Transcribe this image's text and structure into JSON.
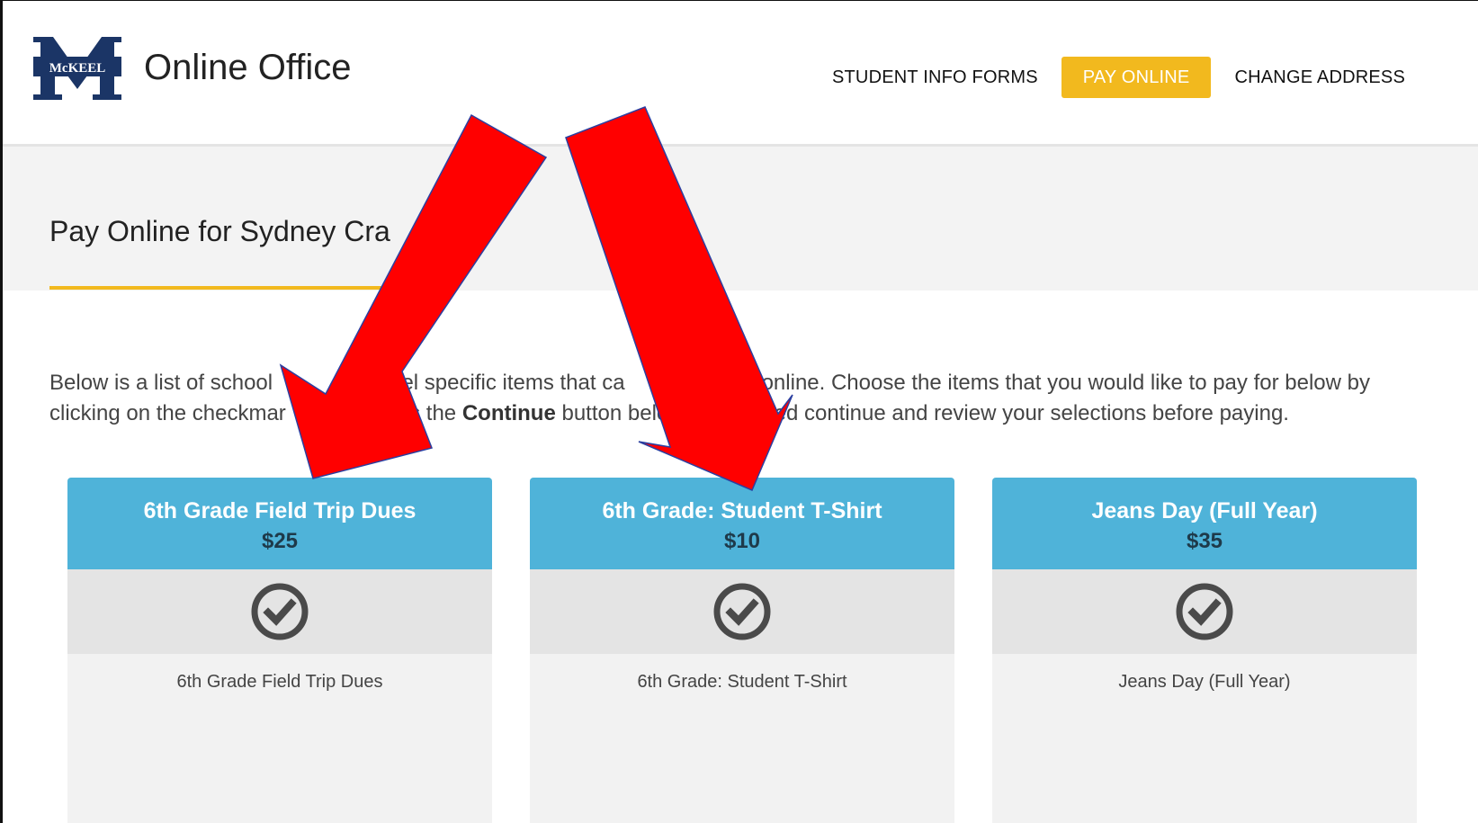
{
  "header": {
    "logo_text_top": "McKEEL",
    "logo_letter": "M",
    "title": "Online Office",
    "nav": [
      {
        "label": "STUDENT INFO FORMS",
        "active": false
      },
      {
        "label": "PAY ONLINE",
        "active": true
      },
      {
        "label": "CHANGE ADDRESS",
        "active": false
      }
    ]
  },
  "page": {
    "title": "Pay Online for Sydney Cra",
    "intro_part1": "Below is a list of school",
    "intro_part2": "vel specific items that ca",
    "intro_part3": "for online. Choose the items that you would like to pay for below by clicking on the checkmar",
    "intro_part4": "s the",
    "intro_bold": "Continue",
    "intro_part5": "button belo",
    "intro_part6": "ed continue and review your selections before paying."
  },
  "cards": [
    {
      "title": "6th Grade Field Trip Dues",
      "price": "$25",
      "description": "6th Grade Field Trip Dues"
    },
    {
      "title": "6th Grade: Student T-Shirt",
      "price": "$10",
      "description": "6th Grade: Student T-Shirt"
    },
    {
      "title": "Jeans Day (Full Year)",
      "price": "$35",
      "description": "Jeans Day (Full Year)"
    }
  ],
  "colors": {
    "accent": "#f2b91e",
    "card_header": "#4fb3d9",
    "arrow": "#ff0000",
    "logo_navy": "#1b3566"
  },
  "icons": {
    "check": "check-circle-icon",
    "arrow": "red-arrow-annotation"
  }
}
